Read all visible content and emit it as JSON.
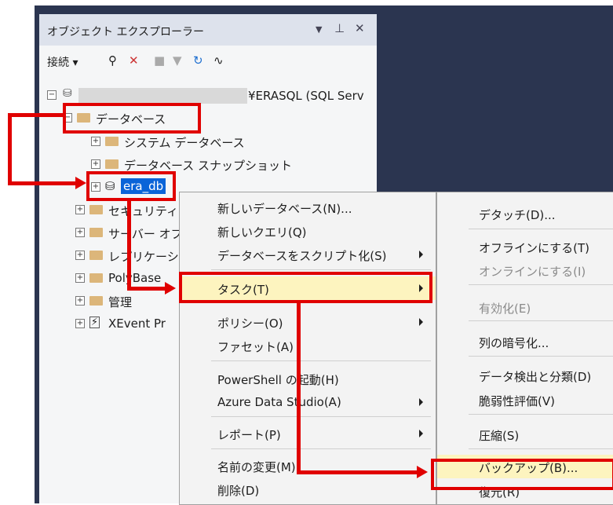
{
  "explorer": {
    "title": "オブジェクト エクスプローラー",
    "toolbar": {
      "connect": "接続"
    },
    "tree": {
      "server": "¥ERASQL (SQL Serv",
      "databases": "データベース",
      "system_db": "システム データベース",
      "snapshots": "データベース スナップショット",
      "era_db": "era_db",
      "security": "セキュリティ",
      "server_objects": "サーバー オブ",
      "replication": "レプリケーシ",
      "polybase": "PolyBase",
      "management": "管理",
      "xevent": "XEvent Pr"
    }
  },
  "context_menu": {
    "items": [
      "新しいデータベース(N)...",
      "新しいクエリ(Q)",
      "データベースをスクリプト化(S)",
      "タスク(T)",
      "ポリシー(O)",
      "ファセット(A)",
      "PowerShell の起動(H)",
      "Azure Data Studio(A)",
      "レポート(P)",
      "名前の変更(M)",
      "削除(D)"
    ]
  },
  "task_menu": {
    "items": [
      "デタッチ(D)...",
      "オフラインにする(T)",
      "オンラインにする(I)",
      "有効化(E)",
      "列の暗号化...",
      "データ検出と分類(D)",
      "脆弱性評価(V)",
      "圧縮(S)",
      "バックアップ(B)...",
      "復元(R)"
    ]
  },
  "colors": {
    "annotation": "#e00000",
    "highlight": "#fdf4bf",
    "selection": "#0a64d8"
  }
}
